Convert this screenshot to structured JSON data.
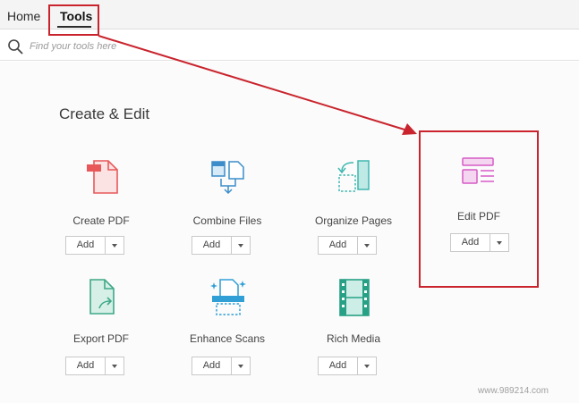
{
  "tabs": [
    {
      "label": "Home"
    },
    {
      "label": "Tools"
    }
  ],
  "search": {
    "placeholder": "Find your tools here"
  },
  "section": {
    "title": "Create & Edit"
  },
  "tools": [
    {
      "label": "Create PDF",
      "icon": "create-pdf-icon",
      "add_label": "Add"
    },
    {
      "label": "Combine Files",
      "icon": "combine-files-icon",
      "add_label": "Add"
    },
    {
      "label": "Organize Pages",
      "icon": "organize-pages-icon",
      "add_label": "Add"
    },
    {
      "label": "Edit PDF",
      "icon": "edit-pdf-icon",
      "add_label": "Add"
    },
    {
      "label": "Export PDF",
      "icon": "export-pdf-icon",
      "add_label": "Add"
    },
    {
      "label": "Enhance Scans",
      "icon": "enhance-scans-icon",
      "add_label": "Add"
    },
    {
      "label": "Rich Media",
      "icon": "rich-media-icon",
      "add_label": "Add"
    }
  ],
  "colors": {
    "annotation": "#c9242d",
    "create_pdf": "#e8585a",
    "combine_files": "#3c8dc9",
    "organize_pages": "#3fb7b0",
    "edit_pdf": "#d65bc6",
    "export_pdf": "#3fa887",
    "enhance_scans": "#2f9fd6",
    "rich_media": "#27a085"
  },
  "watermark": "www.989214.com"
}
